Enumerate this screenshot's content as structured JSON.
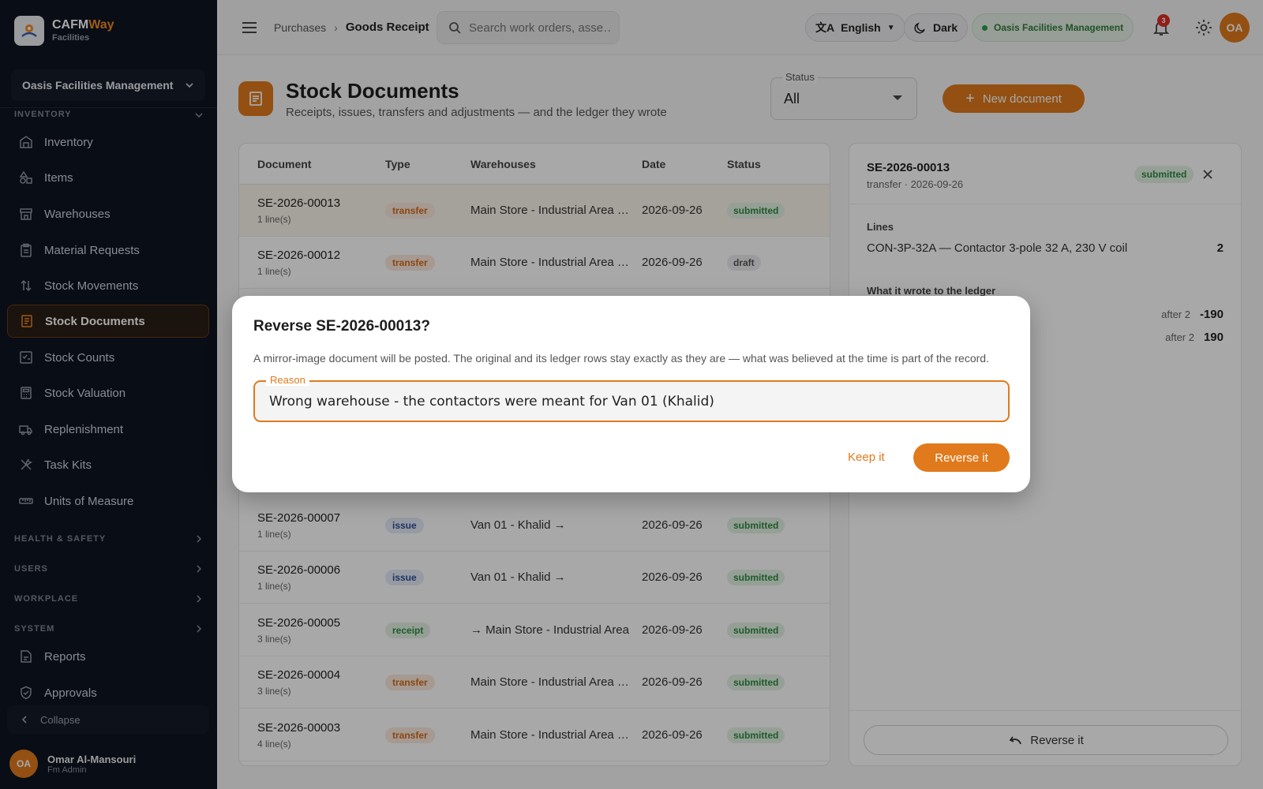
{
  "brand": {
    "name_main": "CAFM",
    "name_accent": "Way",
    "subtitle": "Facilities"
  },
  "org_select": {
    "value": "Oasis Facilities Management"
  },
  "sidebar": {
    "section_inventory": "INVENTORY",
    "items": [
      {
        "label": "Inventory",
        "icon": "warehouse-icon"
      },
      {
        "label": "Items",
        "icon": "shapes-icon"
      },
      {
        "label": "Warehouses",
        "icon": "store-icon"
      },
      {
        "label": "Material Requests",
        "icon": "clipboard-icon"
      },
      {
        "label": "Stock Movements",
        "icon": "swap-vertical-icon"
      },
      {
        "label": "Stock Documents",
        "icon": "document-icon",
        "active": true
      },
      {
        "label": "Stock Counts",
        "icon": "checklist-icon"
      },
      {
        "label": "Stock Valuation",
        "icon": "calculator-icon"
      },
      {
        "label": "Replenishment",
        "icon": "truck-icon"
      },
      {
        "label": "Task Kits",
        "icon": "tools-icon"
      },
      {
        "label": "Units of Measure",
        "icon": "ruler-icon"
      }
    ],
    "sections": [
      "HEALTH & SAFETY",
      "USERS",
      "WORKPLACE",
      "SYSTEM"
    ],
    "bottom_items": [
      {
        "label": "Reports",
        "icon": "report-icon"
      },
      {
        "label": "Approvals",
        "icon": "shield-check-icon"
      }
    ],
    "collapse_label": "Collapse",
    "user": {
      "initials": "OA",
      "name": "Omar Al-Mansouri",
      "role": "Fm Admin"
    }
  },
  "header": {
    "breadcrumb_parent": "Purchases",
    "breadcrumb_current": "Goods Receipt",
    "search_placeholder": "Search work orders, asse…",
    "language": "English",
    "theme": "Dark",
    "org": "Oasis Facilities Management",
    "notification_count": "3",
    "avatar_initials": "OA"
  },
  "page": {
    "title": "Stock Documents",
    "subtitle": "Receipts, issues, transfers and adjustments — and the ledger they wrote",
    "status_label": "Status",
    "status_value": "All",
    "new_button": "New document"
  },
  "table": {
    "columns": [
      "Document",
      "Type",
      "Warehouses",
      "Date",
      "Status"
    ],
    "rows": [
      {
        "doc": "SE-2026-00013",
        "lines": "1 line(s)",
        "type": "transfer",
        "warehouses": "Main Store - Industrial Area → …",
        "date": "2026-09-26",
        "status": "submitted"
      },
      {
        "doc": "SE-2026-00012",
        "lines": "1 line(s)",
        "type": "transfer",
        "warehouses": "Main Store - Industrial Area → …",
        "date": "2026-09-26",
        "status": "draft"
      },
      {
        "doc": "SE-2026-00007",
        "lines": "1 line(s)",
        "type": "issue",
        "warehouses": "Van 01 - Khalid →",
        "date": "2026-09-26",
        "status": "submitted"
      },
      {
        "doc": "SE-2026-00006",
        "lines": "1 line(s)",
        "type": "issue",
        "warehouses": "Van 01 - Khalid →",
        "date": "2026-09-26",
        "status": "submitted"
      },
      {
        "doc": "SE-2026-00005",
        "lines": "3 line(s)",
        "type": "receipt",
        "warehouses": "→ Main Store - Industrial Area",
        "date": "2026-09-26",
        "status": "submitted"
      },
      {
        "doc": "SE-2026-00004",
        "lines": "3 line(s)",
        "type": "transfer",
        "warehouses": "Main Store - Industrial Area → …",
        "date": "2026-09-26",
        "status": "submitted"
      },
      {
        "doc": "SE-2026-00003",
        "lines": "4 line(s)",
        "type": "transfer",
        "warehouses": "Main Store - Industrial Area → …",
        "date": "2026-09-26",
        "status": "submitted"
      }
    ]
  },
  "detail": {
    "title": "SE-2026-00013",
    "subtitle": "transfer · 2026-09-26",
    "status": "submitted",
    "lines_heading": "Lines",
    "line_item": "CON-3P-32A — Contactor 3-pole 32 A, 230 V coil",
    "line_qty": "2",
    "ledger_heading": "What it wrote to the ledger",
    "ledger": [
      {
        "after": "after 2",
        "qty": "-190"
      },
      {
        "after": "after 2",
        "qty": "190"
      }
    ],
    "reverse_button": "Reverse it"
  },
  "dialog": {
    "title": "Reverse SE-2026-00013?",
    "text": "A mirror-image document will be posted. The original and its ledger rows stay exactly as they are — what was believed at the time is part of the record.",
    "reason_label": "Reason",
    "reason_value": "Wrong warehouse - the contactors were meant for Van 01 (Khalid)",
    "keep_button": "Keep it",
    "confirm_button": "Reverse it"
  },
  "colors": {
    "accent": "#e07a1c",
    "sidebar_bg": "#0f1420",
    "success": "#2e8a3e"
  }
}
